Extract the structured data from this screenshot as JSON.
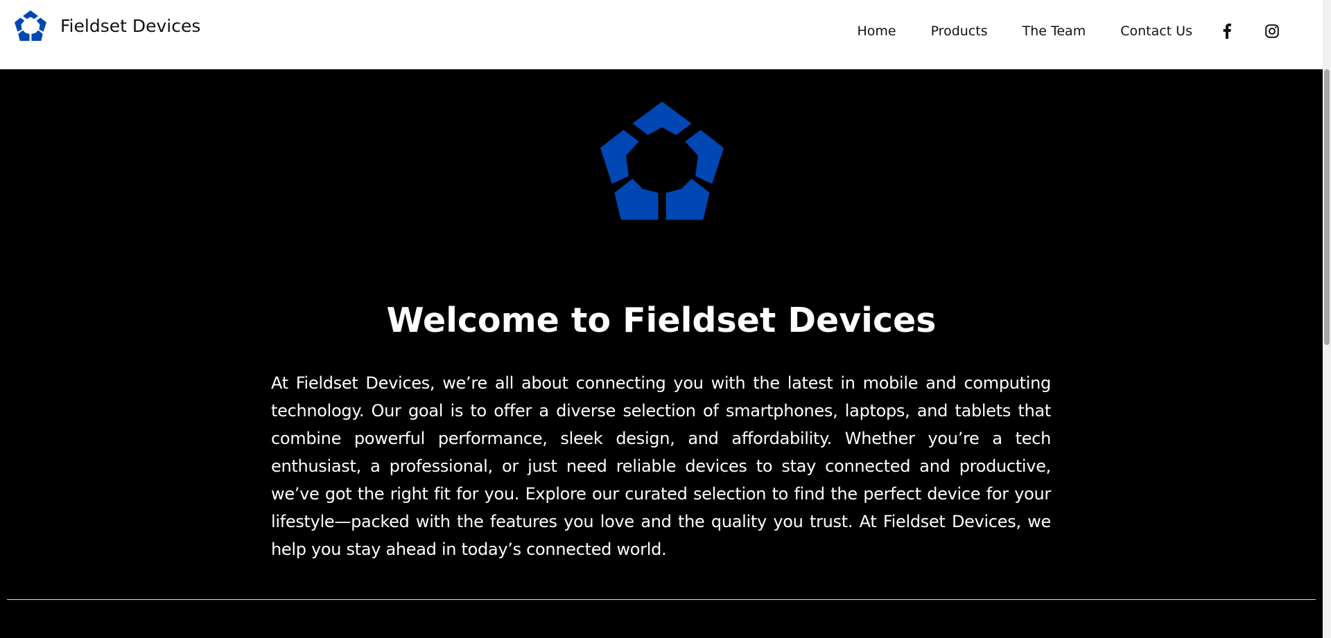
{
  "header": {
    "brand_name": "Fieldset Devices",
    "logo_icon": "pentagon-logo-icon",
    "nav": [
      {
        "label": "Home"
      },
      {
        "label": "Products"
      },
      {
        "label": "The Team"
      },
      {
        "label": "Contact Us"
      }
    ],
    "social": [
      {
        "icon": "facebook-icon"
      },
      {
        "icon": "instagram-icon"
      }
    ]
  },
  "hero": {
    "logo_icon": "pentagon-logo-icon",
    "title": "Welcome to Fieldset Devices",
    "description": "At Fieldset Devices, we’re all about connecting you with the latest in mobile and computing technology. Our goal is to offer a diverse selection of smartphones, laptops, and tablets that combine powerful performance, sleek design, and affordability. Whether you’re a tech enthusiast, a professional, or just need reliable devices to stay connected and productive, we’ve got the right fit for you. Explore our curated selection to find the perfect device for your lifestyle—packed with the features you love and the quality you trust. At Fieldset Devices, we help you stay ahead in today’s connected world."
  },
  "colors": {
    "brand_blue": "#0047b3",
    "header_bg": "#ffffff",
    "hero_bg": "#000000",
    "text_dark": "#111111",
    "text_light": "#ffffff"
  }
}
